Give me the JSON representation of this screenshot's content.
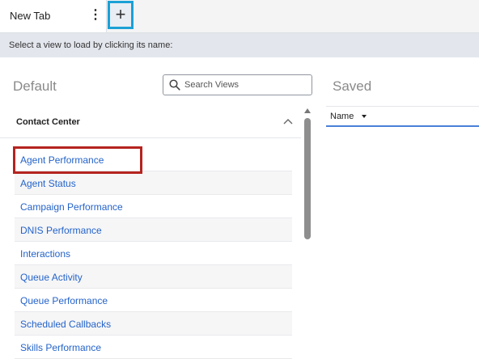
{
  "tabs": [
    {
      "label": "New Tab"
    }
  ],
  "icons": {
    "tab_menu": "kebab-menu-icon",
    "add_tab": "plus-icon",
    "search": "search-icon",
    "collapse": "chevron-up-icon",
    "sort": "caret-down-icon"
  },
  "instruction": "Select a view to load by clicking its name:",
  "default_panel": {
    "title": "Default",
    "search_placeholder": "Search Views",
    "group": {
      "title": "Contact Center",
      "items": [
        {
          "label": "Agent Performance",
          "highlighted": true
        },
        {
          "label": "Agent Status"
        },
        {
          "label": "Campaign Performance"
        },
        {
          "label": "DNIS Performance"
        },
        {
          "label": "Interactions"
        },
        {
          "label": "Queue Activity"
        },
        {
          "label": "Queue Performance"
        },
        {
          "label": "Scheduled Callbacks"
        },
        {
          "label": "Skills Performance"
        }
      ]
    }
  },
  "saved_panel": {
    "title": "Saved",
    "column": "Name"
  },
  "colors": {
    "link": "#2463c9",
    "highlight": "#b5241f",
    "add_tab_border": "#1aa1d6",
    "column_underline": "#4a80d9"
  }
}
